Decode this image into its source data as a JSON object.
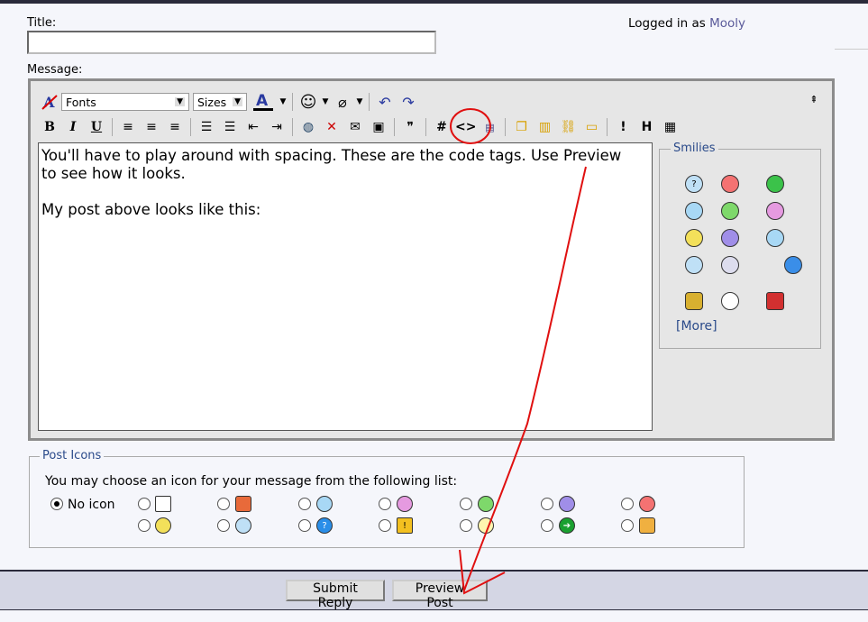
{
  "form": {
    "title_label": "Title:",
    "message_label": "Message:",
    "title_value": ""
  },
  "login": {
    "prefix": "Logged in as",
    "username": "Mooly"
  },
  "toolbar": {
    "fonts_label": "Fonts",
    "sizes_label": "Sizes",
    "bold": "B",
    "italic": "I",
    "underline": "U",
    "code": "#",
    "html": "<>",
    "font_color": "A"
  },
  "editor": {
    "text": "You'll have to play around with spacing. These are the code tags. Use Preview\nto see how it looks.\n\nMy post above looks like this:"
  },
  "smilies": {
    "legend": "Smilies",
    "more": "[More]"
  },
  "post_icons": {
    "legend": "Post Icons",
    "instruction": "You may choose an icon for your message from the following list:",
    "no_icon": "No icon",
    "help_glyph": "?",
    "warning_glyph": "!"
  },
  "buttons": {
    "submit": "Submit Reply",
    "preview": "Preview Post"
  }
}
